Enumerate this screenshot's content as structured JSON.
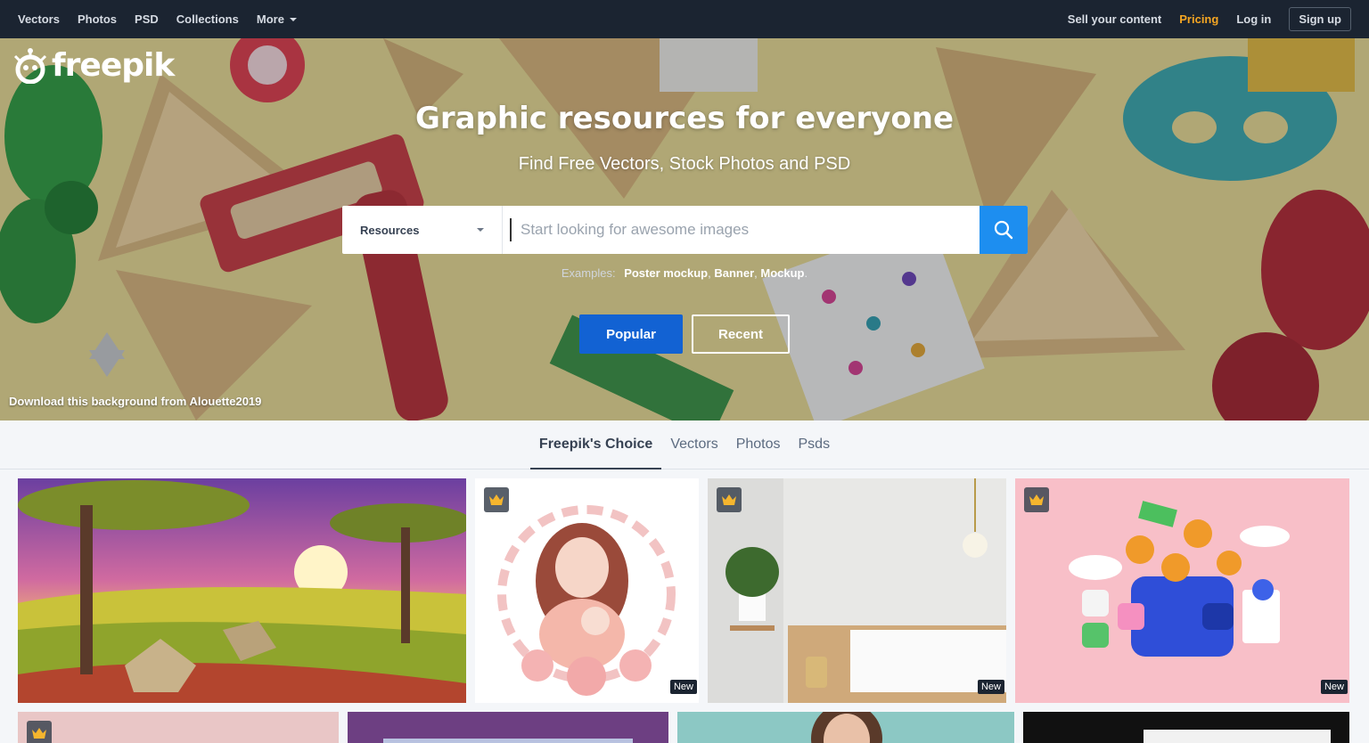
{
  "topnav": {
    "left": [
      {
        "label": "Vectors"
      },
      {
        "label": "Photos"
      },
      {
        "label": "PSD"
      },
      {
        "label": "Collections"
      },
      {
        "label": "More"
      }
    ],
    "sell": "Sell your content",
    "pricing": "Pricing",
    "login": "Log in",
    "signup": "Sign up"
  },
  "hero": {
    "logo_text": "freepik",
    "title": "Graphic resources for everyone",
    "subtitle": "Find Free Vectors, Stock Photos and PSD",
    "search": {
      "category": "Resources",
      "placeholder": "Start looking for awesome images"
    },
    "examples_label": "Examples:",
    "examples": [
      "Poster mockup",
      "Banner",
      "Mockup"
    ],
    "popular": "Popular",
    "recent": "Recent",
    "attribution": "Download this background from Alouette2019"
  },
  "tabs": [
    {
      "label": "Freepik's Choice",
      "active": true
    },
    {
      "label": "Vectors"
    },
    {
      "label": "Photos"
    },
    {
      "label": "Psds"
    }
  ],
  "cards": {
    "new_label": "New",
    "items": [
      {
        "subject": "savanna sunset landscape",
        "premium": false,
        "is_new": false
      },
      {
        "subject": "mother and baby floral watercolor",
        "premium": true,
        "is_new": true
      },
      {
        "subject": "minimal interior with plant",
        "premium": true,
        "is_new": true
      },
      {
        "subject": "3d wallet with coins",
        "premium": true,
        "is_new": true
      }
    ]
  },
  "colors": {
    "nav_bg": "#1b2431",
    "pricing": "#f5a623",
    "search_btn": "#1d8ef0",
    "popular_btn": "#1262d3"
  }
}
